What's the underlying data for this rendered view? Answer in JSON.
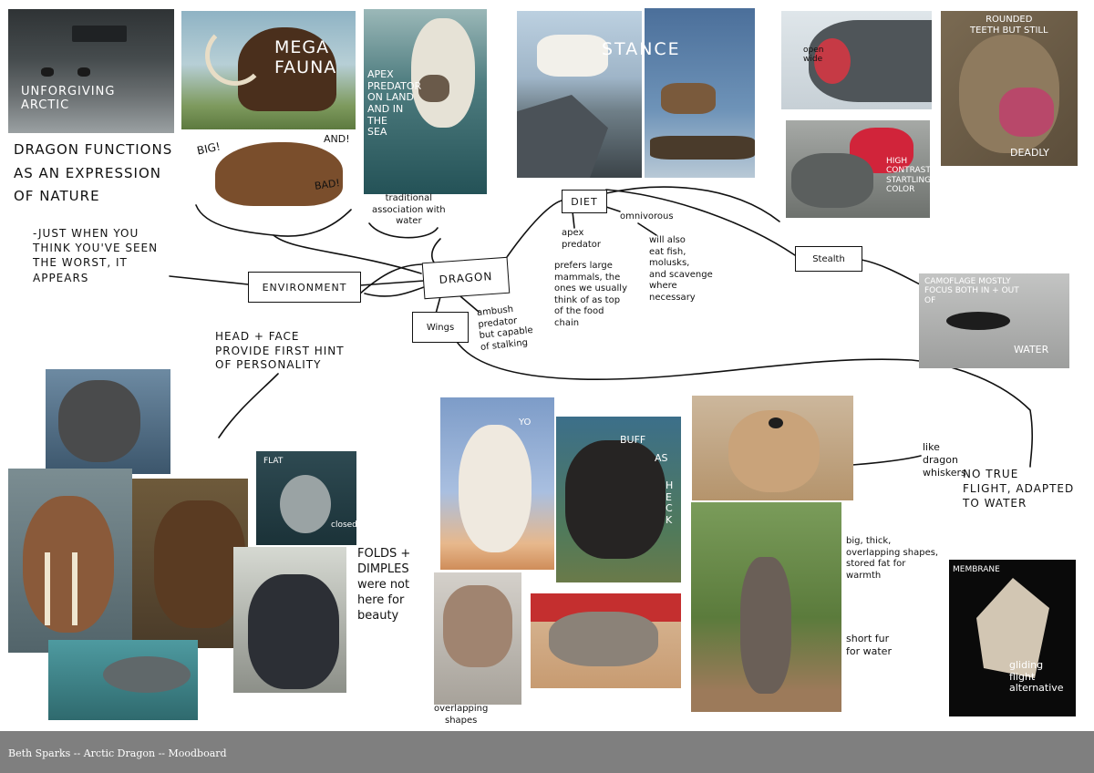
{
  "footer": {
    "caption": "Beth Sparks -- Arctic Dragon -- Moodboard"
  },
  "photo_text": {
    "arctic": "UNFORGIVING\nARCTIC",
    "mega": "MEGA\nFAUNA",
    "polar": "APEX\nPREDATOR\nON LAND\nAND IN\nTHE\nSEA",
    "stance": "STANCE",
    "open_wide": "open\nwide",
    "rounded": "ROUNDED\nTEETH BUT STILL",
    "deadly": "DEADLY",
    "contrast": "HIGH\nCONTRAST,\nSTARTLING\nCOLOR",
    "camo": "CAMOFLAGE MOSTLY\nFOCUS BOTH IN + OUT\nOF",
    "water": "WATER",
    "yo": "YO",
    "buff": "BUFF",
    "as": "AS",
    "heck": "HECK",
    "flat": "FLAT",
    "closed": "closed",
    "membrane": "MEMBRANE",
    "glide": "gliding\nflight\nalternative"
  },
  "notes": {
    "big": "BIG!",
    "and": "AND!",
    "bad": "BAD!",
    "dragon_functions": "DRAGON FUNCTIONS\nAS AN EXPRESSION\nOF NATURE",
    "just_when": "-JUST WHEN YOU\nTHINK YOU'VE SEEN\nTHE WORST, IT\nAPPEARS",
    "traditional": "traditional\nassociation with\nwater",
    "head_face": "HEAD + FACE\nPROVIDE FIRST HINT\nOF PERSONALITY",
    "ambush": "ambush\npredator\nbut capable\nof stalking",
    "apex": "apex\npredator",
    "prefers": "prefers large\nmammals, the\nones we usually\nthink of as top\nof the food\nchain",
    "omnivorous": "omnivorous",
    "will_also": "will also\neat fish,\nmolusks,\nand scavenge\nwhere\nnecessary",
    "like_dragon": "like\ndragon\nwhiskers",
    "no_true": "NO TRUE\nFLIGHT, ADAPTED\nTO WATER",
    "folds": "FOLDS +\nDIMPLES\nwere not\nhere for\nbeauty",
    "big_thick": "big, thick,\noverlapping shapes,\nstored fat for\nwarmth",
    "short_fur": "short fur\nfor water",
    "overlapping": "overlapping\nshapes"
  },
  "mindmap": {
    "dragon": "DRAGON",
    "environment": "ENVIRONMENT",
    "diet": "DIET",
    "wings": "Wings",
    "stealth": "Stealth"
  },
  "colors": {
    "footer_bg": "#7f7f7f",
    "ink": "#111111",
    "paper": "#ffffff"
  }
}
